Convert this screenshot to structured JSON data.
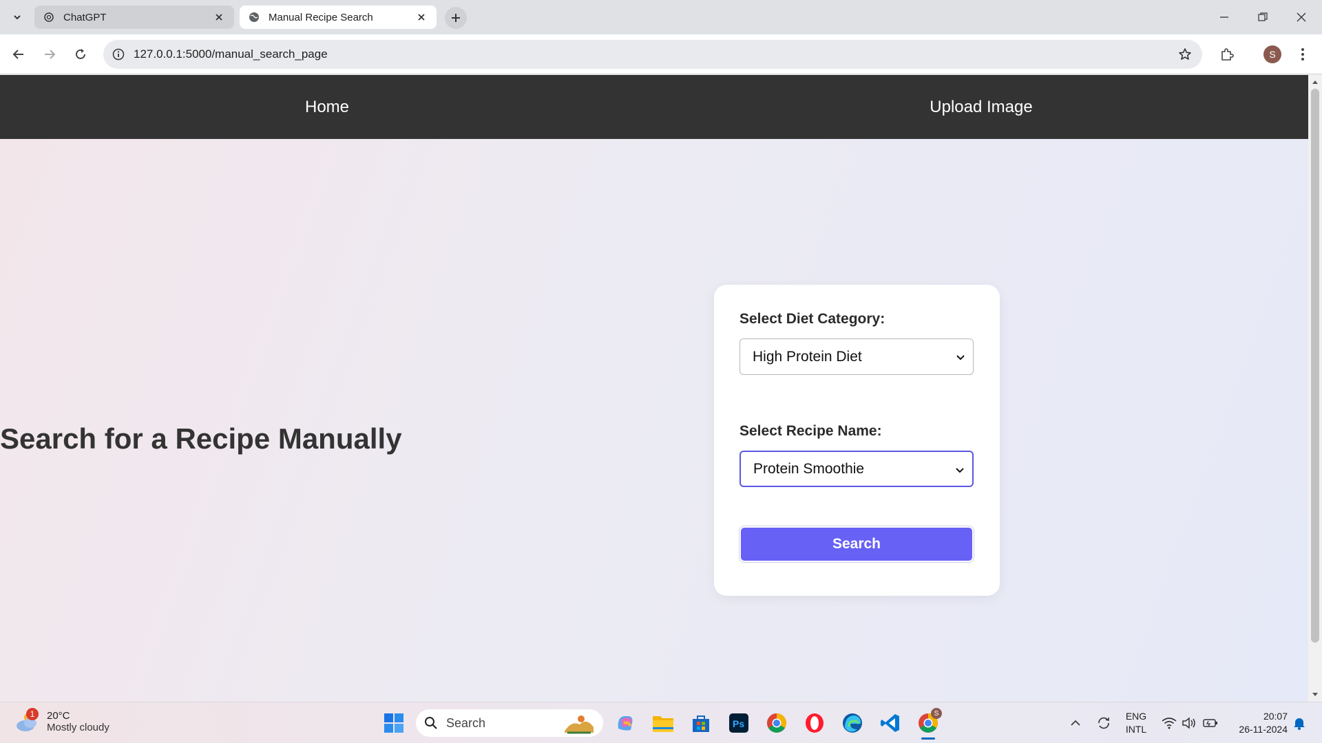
{
  "browser": {
    "tabs": [
      {
        "title": "ChatGPT",
        "active": false,
        "favicon": "chatgpt-icon"
      },
      {
        "title": "Manual Recipe Search",
        "active": true,
        "favicon": "globe-icon"
      }
    ],
    "url": "127.0.0.1:5000/manual_search_page",
    "profile_initial": "S"
  },
  "nav": {
    "home": "Home",
    "upload": "Upload Image"
  },
  "page": {
    "heading": "Search for a Recipe Manually"
  },
  "form": {
    "diet_label": "Select Diet Category:",
    "diet_value": "High Protein Diet",
    "recipe_label": "Select Recipe Name:",
    "recipe_value": "Protein Smoothie",
    "search_button": "Search"
  },
  "taskbar": {
    "weather_badge": "1",
    "temperature": "20°C",
    "condition": "Mostly cloudy",
    "search_placeholder": "Search",
    "language_line1": "ENG",
    "language_line2": "INTL",
    "time": "20:07",
    "date": "26-11-2024",
    "chrome_profile_badge": "S"
  },
  "colors": {
    "navbar": "#333333",
    "accent": "#6761f5",
    "focus_border": "#5b57e3",
    "heading_text": "#333333"
  }
}
